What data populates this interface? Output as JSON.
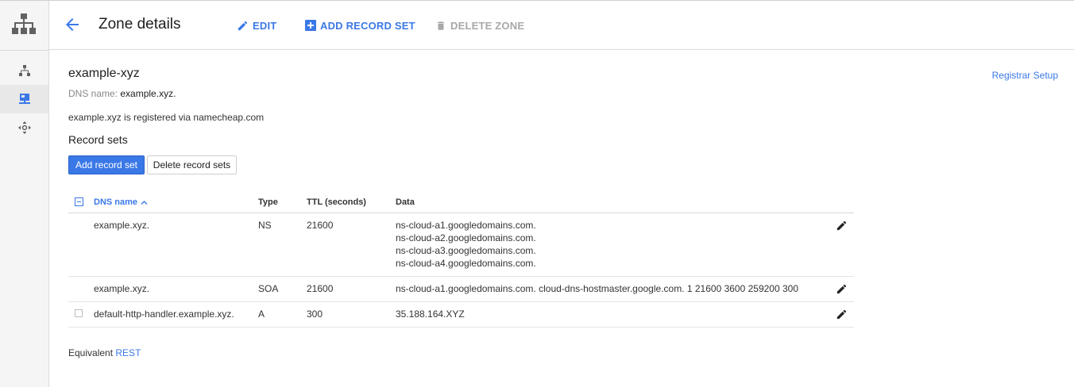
{
  "header": {
    "title": "Zone details",
    "actions": {
      "edit": "EDIT",
      "add_record_set": "ADD RECORD SET",
      "delete_zone": "DELETE ZONE"
    }
  },
  "zone": {
    "name": "example-xyz",
    "dns_name_label": "DNS name:",
    "dns_name_value": "example.xyz.",
    "registered_text": "example.xyz is registered via namecheap.com",
    "registrar_link": "Registrar Setup"
  },
  "record_sets": {
    "title": "Record sets",
    "add_button": "Add record set",
    "delete_button": "Delete record sets",
    "columns": {
      "name": "DNS name",
      "type": "Type",
      "ttl": "TTL (seconds)",
      "data": "Data"
    },
    "rows": [
      {
        "name": "example.xyz.",
        "type": "NS",
        "ttl": "21600",
        "data": [
          "ns-cloud-a1.googledomains.com.",
          "ns-cloud-a2.googledomains.com.",
          "ns-cloud-a3.googledomains.com.",
          "ns-cloud-a4.googledomains.com."
        ]
      },
      {
        "name": "example.xyz.",
        "type": "SOA",
        "ttl": "21600",
        "data": [
          "ns-cloud-a1.googledomains.com. cloud-dns-hostmaster.google.com. 1 21600 3600 259200 300"
        ]
      },
      {
        "name": "default-http-handler.example.xyz.",
        "type": "A",
        "ttl": "300",
        "data": [
          "35.188.164.XYZ"
        ]
      }
    ]
  },
  "footer": {
    "equivalent_label": "Equivalent",
    "rest_link": "REST"
  },
  "colors": {
    "accent": "#3b78e7",
    "disabled": "#a8a8a8",
    "text": "#212121"
  }
}
